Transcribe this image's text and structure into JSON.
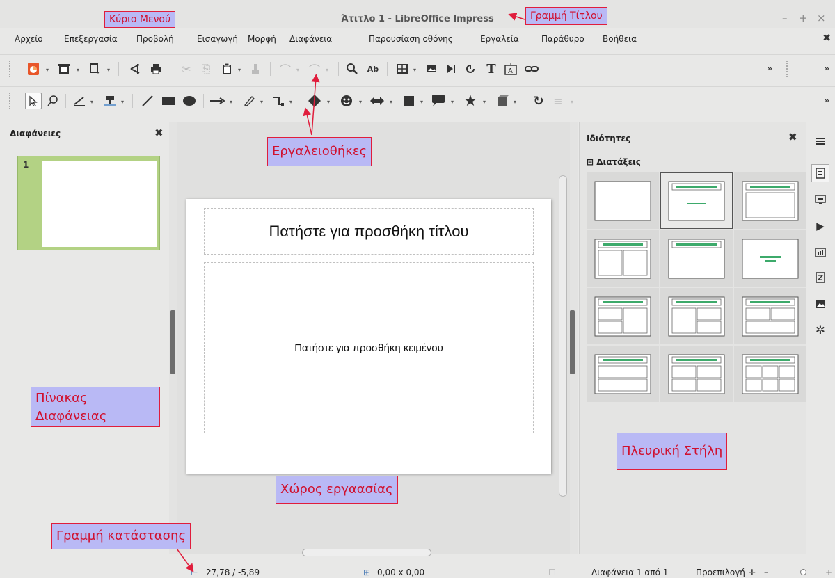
{
  "window": {
    "title": "Άτιτλο 1 - LibreOffice Impress",
    "controls": [
      "–",
      "+",
      "×"
    ]
  },
  "menu": {
    "items": [
      "Αρχείο",
      "Επεξεργασία",
      "Προβολή",
      "Εισαγωγή",
      "Μορφή",
      "Διαφάνεια",
      "Παρουσίαση οθόνης",
      "Εργαλεία",
      "Παράθυρο",
      "Βοήθεια"
    ],
    "close_symbol": "✖"
  },
  "toolbar1": {
    "icons": [
      "impress-logo-icon",
      "new-icon",
      "open-icon",
      "save-icon",
      "cut-icon",
      "print-icon",
      "undo-icon",
      "redo-icon",
      "paste-icon",
      "clone-format-icon",
      "find-icon",
      "spellcheck-icon",
      "table-icon",
      "image-icon",
      "media-icon",
      "chart-icon",
      "textbox-icon",
      "fontwork-icon",
      "hyperlink-icon"
    ],
    "overflow": "»"
  },
  "toolbar2": {
    "icons": [
      "select-icon",
      "zoom-icon",
      "line-color-icon",
      "fill-color-icon",
      "line-icon",
      "rectangle-icon",
      "ellipse-icon",
      "arrow-icon",
      "curve-icon",
      "connector-icon",
      "diamond-icon",
      "smiley-icon",
      "double-arrow-icon",
      "flowchart-icon",
      "callout-icon",
      "star-icon",
      "3d-object-icon",
      "rotate-icon",
      "align-icon"
    ],
    "overflow": "»"
  },
  "slides_panel": {
    "title": "Διαφάνειες",
    "slide_number": "1",
    "close_symbol": "✖"
  },
  "slide": {
    "title_placeholder": "Πατήστε για προσθήκη τίτλου",
    "body_placeholder": "Πατήστε για προσθήκη κειμένου"
  },
  "sidebar": {
    "title": "Ιδιότητες",
    "close_symbol": "✖",
    "section": "Διατάξεις",
    "section_toggle": "⊟",
    "layouts_count": 12,
    "selected_layout": 2,
    "accent_color": "#3daa6b"
  },
  "deck_icons": [
    "menu-icon",
    "properties-icon",
    "slide-transition-icon",
    "animation-icon",
    "master-slides-icon",
    "styles-icon",
    "gallery-icon",
    "navigator-icon"
  ],
  "status": {
    "position": "27,78 / -5,89",
    "size": "0,00 x 0,00",
    "slide_info": "Διαφάνεια 1 από 1",
    "master": "Προεπιλογή",
    "zoom_minus": "–",
    "zoom_plus": "+"
  },
  "annotations": {
    "main_menu": "Κύριο Μενού",
    "title_bar": "Γραμμή Τίτλου",
    "toolbars": "Εργαλειοθήκες",
    "slide_pane_line1": "Πίνακας",
    "slide_pane_line2": "Διαφάνειας",
    "workspace": "Χώρος εργαασίας",
    "sidebar": "Πλευρική Στήλη",
    "status_bar": "Γραμμή κατάστασης"
  }
}
